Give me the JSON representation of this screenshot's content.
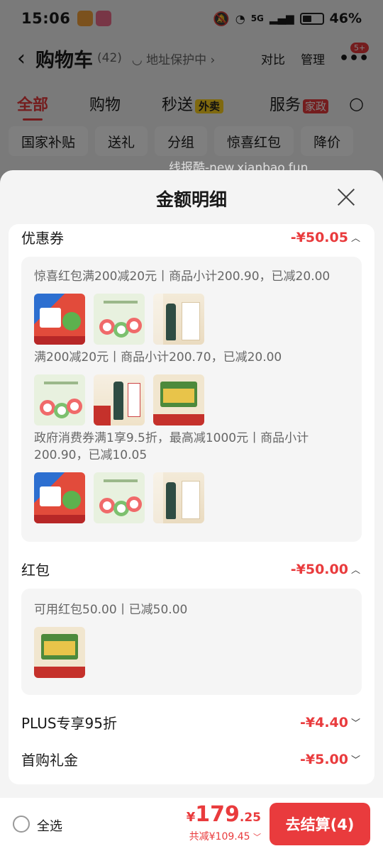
{
  "status_bar": {
    "time": "15:06",
    "network": "5G",
    "battery": "46%"
  },
  "nav": {
    "title": "购物车",
    "count": "(42)",
    "address_protect": "地址保护中",
    "compare": "对比",
    "manage": "管理",
    "more_badge": "5+"
  },
  "tabs": [
    {
      "label": "全部"
    },
    {
      "label": "购物"
    },
    {
      "label": "秒送",
      "tag": "外卖"
    },
    {
      "label": "服务",
      "tag": "家政"
    }
  ],
  "chips": [
    "国家补贴",
    "送礼",
    "分组",
    "惊喜红包",
    "降价"
  ],
  "watermark": "线报酷-new.xianbao.fun",
  "sheet": {
    "title": "金额明细",
    "coupon": {
      "label": "优惠券",
      "amount": "-¥50.05",
      "groups": [
        {
          "desc": "惊喜红包满200减20元丨商品小计200.90，已减20.00"
        },
        {
          "desc": "满200减20元丨商品小计200.70，已减20.00"
        },
        {
          "desc": "政府消费券满1享9.5折，最高减1000元丨商品小计200.90，已减10.05"
        }
      ]
    },
    "red_packet": {
      "label": "红包",
      "amount": "-¥50.00",
      "desc": "可用红包50.00丨已减50.00"
    },
    "plus": {
      "label": "PLUS专享95折",
      "amount": "-¥4.40"
    },
    "first_gift": {
      "label": "首购礼金",
      "amount": "-¥5.00"
    }
  },
  "bottom": {
    "select_all": "全选",
    "currency": "¥",
    "price_int": "179",
    "price_dec": ".25",
    "saved": "共减¥109.45",
    "checkout": "去结算(4)"
  }
}
